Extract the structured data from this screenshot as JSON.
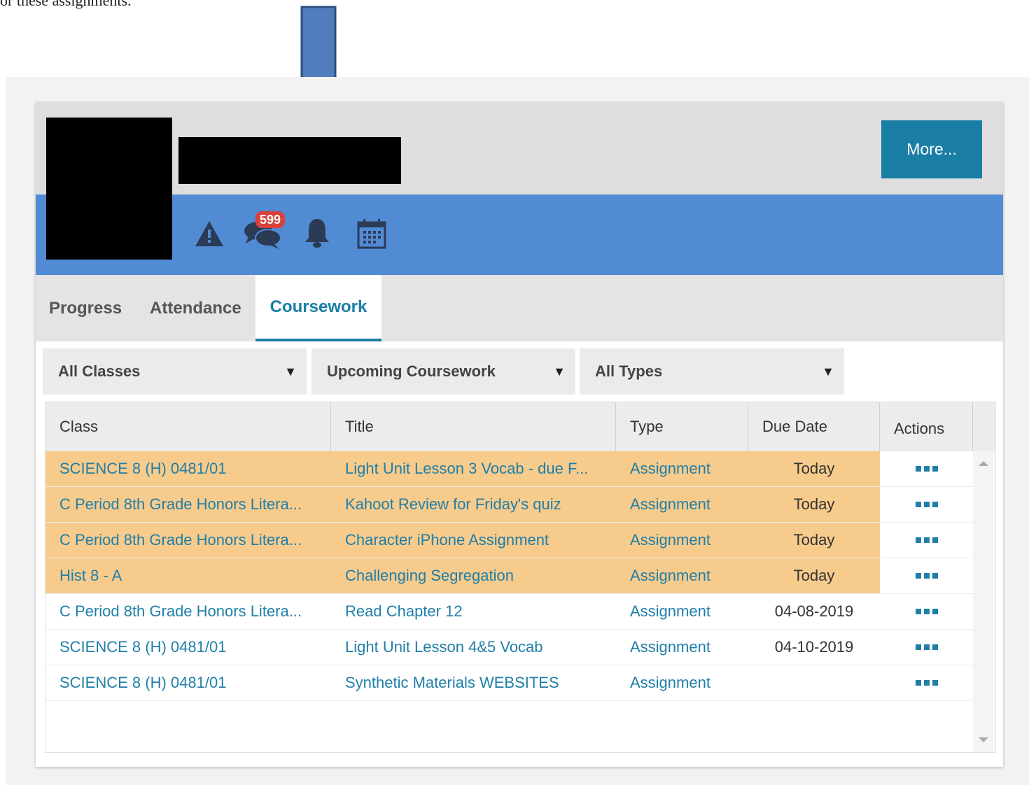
{
  "document": {
    "top_text": "or these assignments."
  },
  "header": {
    "more_label": "More...",
    "message_count": "599"
  },
  "icons": {
    "alert": "warning-icon",
    "messages": "chat-bubbles-icon",
    "notifications": "bell-icon",
    "calendar": "calendar-icon"
  },
  "tabs": [
    {
      "label": "Progress",
      "active": false
    },
    {
      "label": "Attendance",
      "active": false
    },
    {
      "label": "Coursework",
      "active": true
    }
  ],
  "filters": [
    {
      "label": "All Classes"
    },
    {
      "label": "Upcoming Coursework"
    },
    {
      "label": "All Types"
    }
  ],
  "table": {
    "columns": [
      "Class",
      "Title",
      "Type",
      "Due Date",
      "Actions"
    ],
    "rows": [
      {
        "class": "SCIENCE 8 (H) 0481/01",
        "title": "Light Unit Lesson 3 Vocab - due F...",
        "type": "Assignment",
        "due": "Today",
        "highlight": true
      },
      {
        "class": "C Period 8th Grade Honors Litera...",
        "title": "Kahoot Review for Friday's quiz",
        "type": "Assignment",
        "due": "Today",
        "highlight": true
      },
      {
        "class": "C Period 8th Grade Honors Litera...",
        "title": "Character iPhone Assignment",
        "type": "Assignment",
        "due": "Today",
        "highlight": true
      },
      {
        "class": "Hist 8 - A",
        "title": "Challenging Segregation",
        "type": "Assignment",
        "due": "Today",
        "highlight": true
      },
      {
        "class": "C Period 8th Grade Honors Litera...",
        "title": "Read Chapter 12",
        "type": "Assignment",
        "due": "04-08-2019",
        "highlight": false
      },
      {
        "class": "SCIENCE 8 (H) 0481/01",
        "title": "Light Unit Lesson 4&5 Vocab",
        "type": "Assignment",
        "due": "04-10-2019",
        "highlight": false
      },
      {
        "class": "SCIENCE 8 (H) 0481/01",
        "title": "Synthetic Materials WEBSITES",
        "type": "Assignment",
        "due": "",
        "highlight": false
      }
    ]
  },
  "colors": {
    "header_gray": "#dedede",
    "blue_bar": "#518bd4",
    "accent_teal": "#1b7ea5",
    "highlight_row": "#f7cb8c",
    "badge_red": "#d8403a",
    "arrow_blue": "#4f7dbd"
  }
}
